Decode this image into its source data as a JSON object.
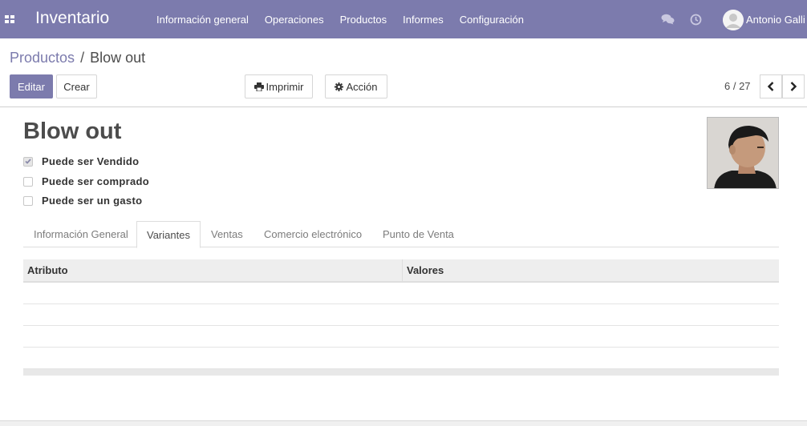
{
  "colors": {
    "brand": "#7c7bad",
    "navbar_text": "#ffffff"
  },
  "navbar": {
    "app_title": "Inventario",
    "menu": [
      {
        "label": "Información general"
      },
      {
        "label": "Operaciones"
      },
      {
        "label": "Productos"
      },
      {
        "label": "Informes"
      },
      {
        "label": "Configuración"
      }
    ],
    "icons": [
      "apps-icon",
      "chat-icon",
      "clock-icon"
    ],
    "user_name": "Antonio Galli"
  },
  "control_panel": {
    "breadcrumb": {
      "parent": "Productos",
      "separator": "/",
      "current": "Blow out"
    },
    "edit_label": "Editar",
    "create_label": "Crear",
    "print_label": "Imprimir",
    "action_label": "Acción",
    "pager": "6 / 27"
  },
  "form": {
    "name": "Blow out",
    "checkboxes": [
      {
        "label": "Puede ser Vendido",
        "checked": true
      },
      {
        "label": "Puede ser comprado",
        "checked": false
      },
      {
        "label": "Puede ser un gasto",
        "checked": false
      }
    ],
    "tabs": [
      {
        "label": "Información General",
        "active": false
      },
      {
        "label": "Variantes",
        "active": true
      },
      {
        "label": "Ventas",
        "active": false
      },
      {
        "label": "Comercio electrónico",
        "active": false
      },
      {
        "label": "Punto de Venta",
        "active": false
      }
    ],
    "variants_table": {
      "columns": [
        "Atributo",
        "Valores"
      ],
      "rows": []
    }
  }
}
